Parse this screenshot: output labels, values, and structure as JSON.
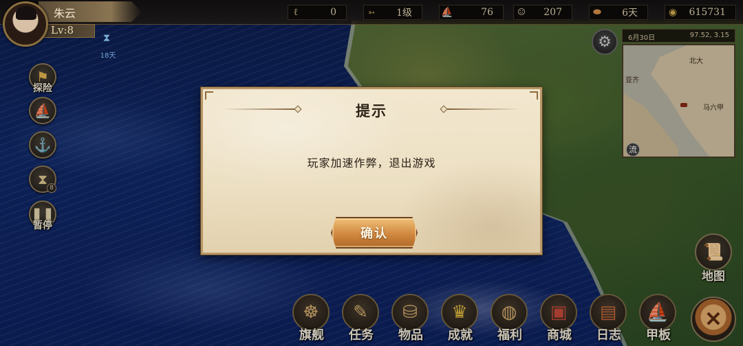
{
  "player": {
    "name": "朱云",
    "level": "Lv:8",
    "timer_label": "18天"
  },
  "resources": [
    {
      "icon": "hook-icon",
      "value": "0"
    },
    {
      "icon": "speed-arrows-icon",
      "value": "1级"
    },
    {
      "icon": "ship-icon",
      "value": "76"
    },
    {
      "icon": "sailor-icon",
      "value": "207"
    },
    {
      "icon": "bread-icon",
      "value": "6天"
    },
    {
      "icon": "coin-icon",
      "value": "615731"
    }
  ],
  "side_buttons": {
    "explore": "探险",
    "pause": "暂停",
    "hourglass_badge": "8"
  },
  "minimap": {
    "date": "6月30日",
    "coords": "97.52, 3.15",
    "labels": {
      "north": "北大",
      "aceh": "亚齐",
      "malacca": "马六甲"
    },
    "flow_button": "流"
  },
  "map_button": {
    "label": "地图"
  },
  "bottom_menu": [
    {
      "key": "flagship",
      "label": "旗舰",
      "icon": "ship-wheel-icon"
    },
    {
      "key": "quests",
      "label": "任务",
      "icon": "scroll-quill-icon"
    },
    {
      "key": "items",
      "label": "物品",
      "icon": "satchel-icon"
    },
    {
      "key": "achievements",
      "label": "成就",
      "icon": "trophy-icon"
    },
    {
      "key": "welfare",
      "label": "福利",
      "icon": "money-bag-icon"
    },
    {
      "key": "shop",
      "label": "商城",
      "icon": "treasure-chest-icon"
    },
    {
      "key": "log",
      "label": "日志",
      "icon": "journal-icon"
    },
    {
      "key": "deck",
      "label": "甲板",
      "icon": "sailing-ship-icon"
    }
  ],
  "dialog": {
    "title": "提示",
    "message": "玩家加速作弊，退出游戏",
    "confirm_label": "确认"
  }
}
